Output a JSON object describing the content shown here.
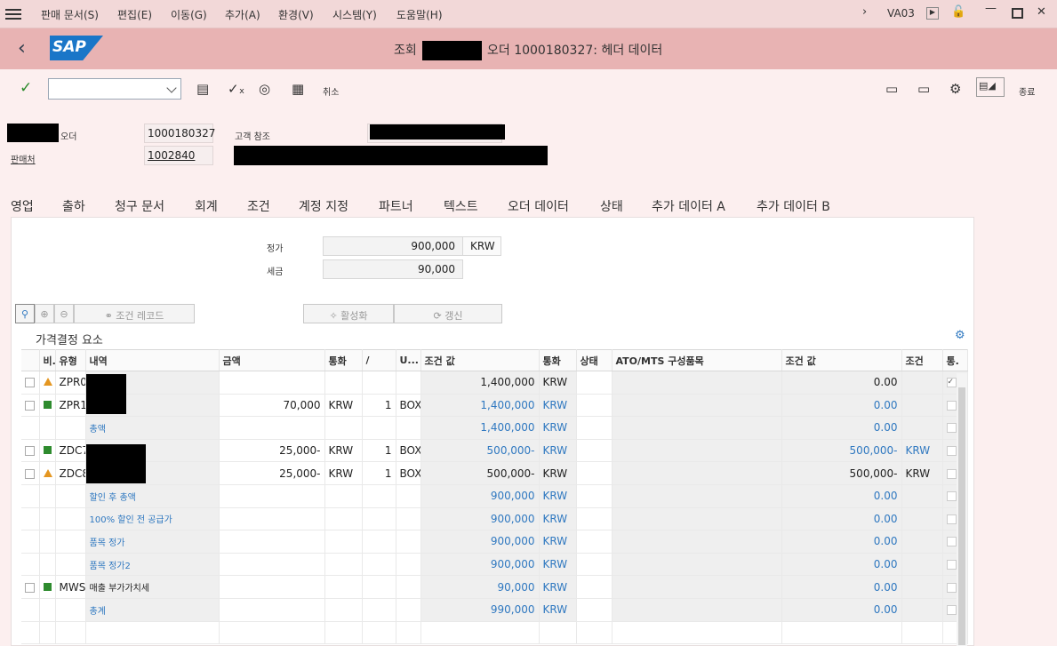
{
  "menubar": {
    "items": [
      "판매 문서(S)",
      "편집(E)",
      "이동(G)",
      "추가(A)",
      "환경(V)",
      "시스템(Y)",
      "도움말(H)"
    ],
    "tcode": "VA03"
  },
  "title": {
    "prefix": "조회",
    "rest": "오더 1000180327: 헤더 데이터"
  },
  "toolbar": {
    "cancel": "취소",
    "exit": "종료"
  },
  "header": {
    "order_label": "오더",
    "order_value": "1000180327",
    "custref_label": "고객 참조",
    "soldto_label": "판매처",
    "soldto_value": "1002840"
  },
  "tabs": [
    "영업",
    "출하",
    "청구 문서",
    "회계",
    "조건",
    "계정 지정",
    "파트너",
    "텍스트",
    "오더 데이터",
    "상태",
    "추가 데이터 A",
    "추가 데이터 B"
  ],
  "active_tab": "조건",
  "summary": {
    "net_label": "정가",
    "net_value": "900,000",
    "currency": "KRW",
    "tax_label": "세금",
    "tax_value": "90,000"
  },
  "buttons": {
    "cond_record": "조건 레코드",
    "activate": "활성화",
    "update": "갱신"
  },
  "section_title": "가격결정 요소",
  "table": {
    "headers": [
      "비.",
      "유형",
      "내역",
      "금액",
      "통화",
      "/",
      "U...",
      "조건 값",
      "통화",
      "상태",
      "ATO/MTS 구성품목",
      "조건 값",
      "조건",
      "통."
    ],
    "rows": [
      {
        "cb": true,
        "icon": "triangle",
        "type": "ZPR0",
        "desc": "",
        "amount": "",
        "cur": "",
        "per": "",
        "uom": "",
        "cval": "1,400,000",
        "ccur": "KRW",
        "stat": "",
        "ato": "0.00",
        "cond": "",
        "blue": false,
        "last_checked": true
      },
      {
        "cb": true,
        "icon": "square",
        "type": "ZPR1",
        "desc": "",
        "amount": "70,000",
        "cur": "KRW",
        "per": "1",
        "uom": "BOX",
        "cval": "1,400,000",
        "ccur": "KRW",
        "stat": "",
        "ato": "0.00",
        "cond": "",
        "blue": true
      },
      {
        "cb": false,
        "icon": "",
        "type": "",
        "desc": "총액",
        "amount": "",
        "cur": "",
        "per": "",
        "uom": "",
        "cval": "1,400,000",
        "ccur": "KRW",
        "stat": "",
        "ato": "0.00",
        "cond": "",
        "blue": true
      },
      {
        "cb": true,
        "icon": "square",
        "type": "ZDC7",
        "desc": "",
        "amount": "25,000-",
        "cur": "KRW",
        "per": "1",
        "uom": "BOX",
        "cval": "500,000-",
        "ccur": "KRW",
        "stat": "",
        "ato": "500,000-",
        "cond": "KRW",
        "blue": true
      },
      {
        "cb": true,
        "icon": "triangle",
        "type": "ZDC8",
        "desc": "",
        "amount": "25,000-",
        "cur": "KRW",
        "per": "1",
        "uom": "BOX",
        "cval": "500,000-",
        "ccur": "KRW",
        "stat": "",
        "ato": "500,000-",
        "cond": "KRW",
        "blue": false
      },
      {
        "cb": false,
        "icon": "",
        "type": "",
        "desc": "할인 후 총액",
        "amount": "",
        "cur": "",
        "per": "",
        "uom": "",
        "cval": "900,000",
        "ccur": "KRW",
        "stat": "",
        "ato": "0.00",
        "cond": "",
        "blue": true
      },
      {
        "cb": false,
        "icon": "",
        "type": "",
        "desc": "100% 할인 전 공급가",
        "amount": "",
        "cur": "",
        "per": "",
        "uom": "",
        "cval": "900,000",
        "ccur": "KRW",
        "stat": "",
        "ato": "0.00",
        "cond": "",
        "blue": true
      },
      {
        "cb": false,
        "icon": "",
        "type": "",
        "desc": "품목 정가",
        "amount": "",
        "cur": "",
        "per": "",
        "uom": "",
        "cval": "900,000",
        "ccur": "KRW",
        "stat": "",
        "ato": "0.00",
        "cond": "",
        "blue": true
      },
      {
        "cb": false,
        "icon": "",
        "type": "",
        "desc": "품목 정가2",
        "amount": "",
        "cur": "",
        "per": "",
        "uom": "",
        "cval": "900,000",
        "ccur": "KRW",
        "stat": "",
        "ato": "0.00",
        "cond": "",
        "blue": true
      },
      {
        "cb": true,
        "icon": "square",
        "type": "MWST",
        "desc": "매출 부가가치세",
        "amount": "",
        "cur": "",
        "per": "",
        "uom": "",
        "cval": "90,000",
        "ccur": "KRW",
        "stat": "",
        "ato": "0.00",
        "cond": "",
        "blue": true,
        "desc_black": true
      },
      {
        "cb": false,
        "icon": "",
        "type": "",
        "desc": "총계",
        "amount": "",
        "cur": "",
        "per": "",
        "uom": "",
        "cval": "990,000",
        "ccur": "KRW",
        "stat": "",
        "ato": "0.00",
        "cond": "",
        "blue": true
      }
    ]
  }
}
